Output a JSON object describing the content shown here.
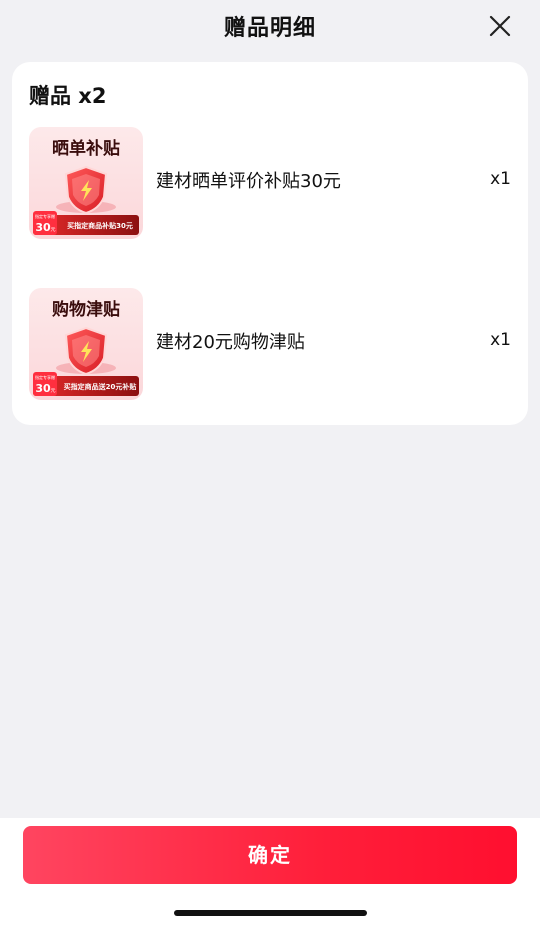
{
  "header": {
    "title": "赠品明细",
    "close_icon": "close-icon"
  },
  "section": {
    "title": "赠品 x2"
  },
  "items": [
    {
      "name": "建材晒单评价补贴30元",
      "qty": "x1",
      "thumb": {
        "headline": "晒单补贴",
        "badge_top": "指定专享赠",
        "badge_value": "30",
        "badge_unit": "元",
        "footer_text": "买指定商品补贴30元"
      }
    },
    {
      "name": "建材20元购物津贴",
      "qty": "x1",
      "thumb": {
        "headline": "购物津贴",
        "badge_top": "指定专享赠",
        "badge_value": "30",
        "badge_unit": "元",
        "footer_text": "买指定商品送20元补贴"
      }
    }
  ],
  "footer": {
    "confirm_label": "确定"
  },
  "colors": {
    "accent": "#ff1f3a",
    "background": "#f1f1f4",
    "card": "#ffffff"
  }
}
